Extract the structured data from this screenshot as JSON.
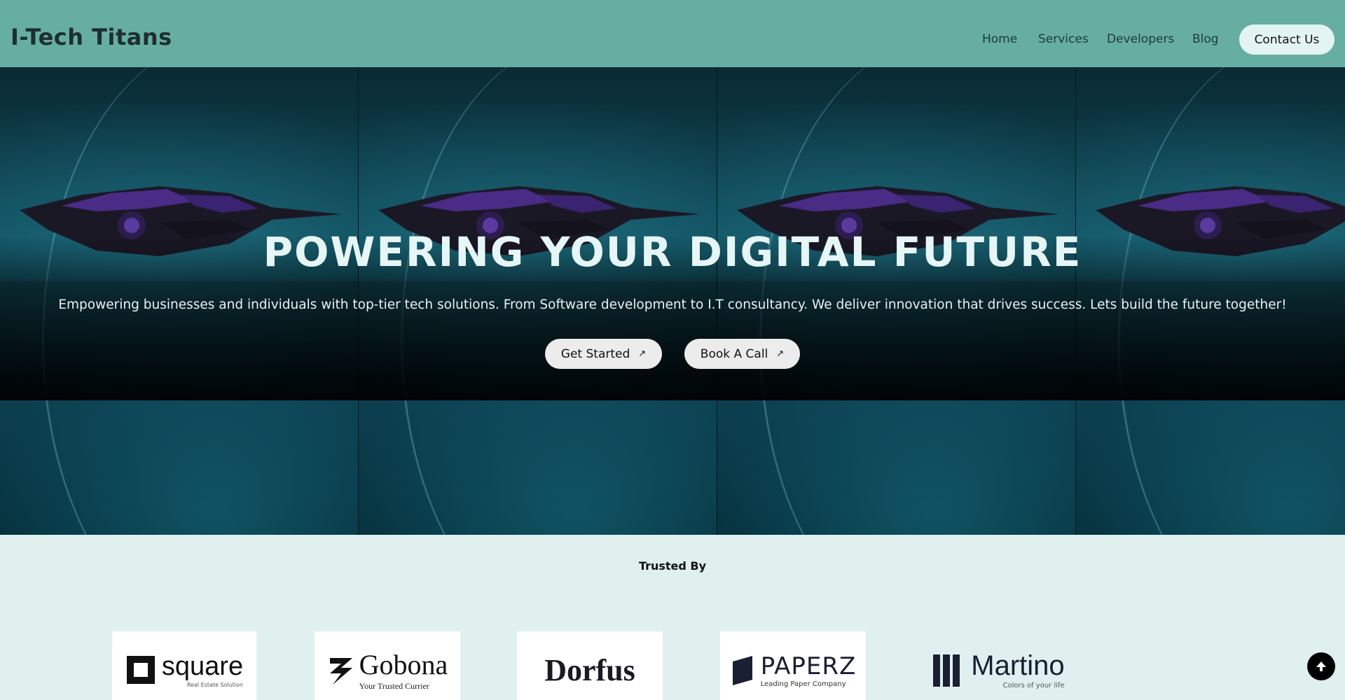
{
  "header": {
    "brand": "I-Tech Titans",
    "nav": {
      "home": "Home",
      "services": "Services",
      "developers": "Developers",
      "blog": "Blog"
    },
    "contact_label": "Contact Us"
  },
  "hero": {
    "title": "POWERING YOUR DIGITAL FUTURE",
    "subtitle": "Empowering businesses and individuals with top-tier tech solutions. From Software development to I.T consultancy. We deliver innovation that drives success. Lets build the future together!",
    "get_started_label": "Get Started",
    "book_call_label": "Book A Call",
    "arrow_icon": "↗"
  },
  "trusted": {
    "title": "Trusted By",
    "logos": [
      {
        "name": "square",
        "tagline": "Real Estate Solution"
      },
      {
        "name": "Gobona",
        "tagline": "Your Trusted Currier"
      },
      {
        "name": "Dorfus",
        "tagline": ""
      },
      {
        "name": "PAPERZ",
        "tagline": "Leading Paper Company"
      },
      {
        "name": "Martino",
        "tagline": "Colors of your life"
      }
    ]
  },
  "scroll_top_icon": "arrow-up-icon",
  "colors": {
    "header_bg": "#67aea2",
    "page_bg": "#dff0ee",
    "hero_title": "#e6f6f6"
  }
}
